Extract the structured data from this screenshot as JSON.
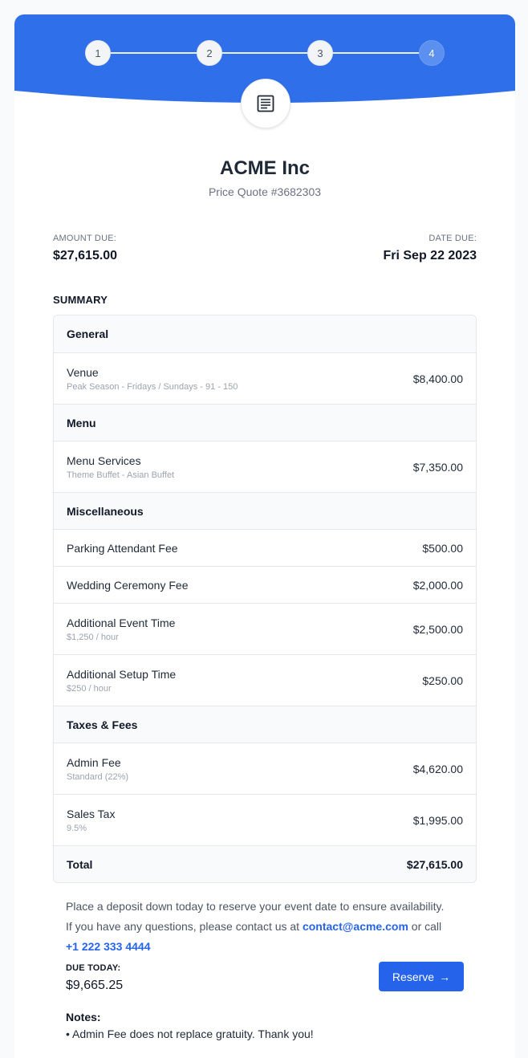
{
  "stepper": {
    "steps": [
      "1",
      "2",
      "3",
      "4"
    ],
    "active_step": 4
  },
  "colors": {
    "primary": "#2f6fe9",
    "accent": "#2563eb",
    "step_active": "#5b8ff0"
  },
  "header": {
    "icon": "document-list-icon",
    "company": "ACME Inc",
    "quote_number": "Price Quote #3682303"
  },
  "amount_due": {
    "label": "AMOUNT DUE:",
    "value": "$27,615.00"
  },
  "date_due": {
    "label": "DATE DUE:",
    "value": "Fri Sep 22 2023"
  },
  "summary": {
    "label": "SUMMARY",
    "sections": [
      {
        "title": "General",
        "items": [
          {
            "name": "Venue",
            "sub": "Peak Season - Fridays / Sundays - 91 - 150",
            "amount": "$8,400.00"
          }
        ]
      },
      {
        "title": "Menu",
        "items": [
          {
            "name": "Menu Services",
            "sub": "Theme Buffet - Asian Buffet",
            "amount": "$7,350.00"
          }
        ]
      },
      {
        "title": "Miscellaneous",
        "items": [
          {
            "name": "Parking Attendant Fee",
            "sub": "",
            "amount": "$500.00"
          },
          {
            "name": "Wedding Ceremony Fee",
            "sub": "",
            "amount": "$2,000.00"
          },
          {
            "name": "Additional Event Time",
            "sub": "$1,250 / hour",
            "amount": "$2,500.00"
          },
          {
            "name": "Additional Setup Time",
            "sub": "$250 / hour",
            "amount": "$250.00"
          }
        ]
      },
      {
        "title": "Taxes & Fees",
        "items": [
          {
            "name": "Admin Fee",
            "sub": "Standard (22%)",
            "amount": "$4,620.00"
          },
          {
            "name": "Sales Tax",
            "sub": "9.5%",
            "amount": "$1,995.00"
          }
        ]
      }
    ],
    "total_label": "Total",
    "total_value": "$27,615.00"
  },
  "deposit": {
    "line1": "Place a deposit down today to reserve your event date to ensure availability.",
    "line2_prefix": "If you have any questions, please contact us at ",
    "email": "contact@acme.com",
    "line2_middle": " or call",
    "phone": "+1 222 333 4444"
  },
  "due_today": {
    "label": "DUE TODAY:",
    "value": "$9,665.25"
  },
  "reserve_button": {
    "label": "Reserve",
    "icon": "arrow-right-icon"
  },
  "notes": {
    "label": "Notes:",
    "items": [
      "• Admin Fee does not replace gratuity. Thank you!"
    ]
  }
}
